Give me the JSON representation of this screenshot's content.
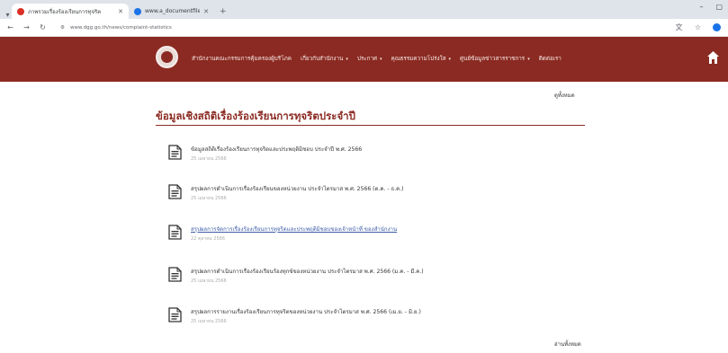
{
  "browser": {
    "tabs": [
      {
        "title": "ภาพรวมเรื่องร้องเรียนการทุจริต",
        "icon": "site-favicon",
        "active": true
      },
      {
        "title": "www.a_documentfile.pdf",
        "icon": "pdf-favicon",
        "active": false
      }
    ],
    "url": "www.dgg.go.th/news/complaint-statistics"
  },
  "site": {
    "nav": [
      {
        "label": "สำนักงานคณะกรรมการคุ้มครองผู้บริโภค",
        "dropdown": false
      },
      {
        "label": "เกี่ยวกับสำนักงาน",
        "dropdown": true
      },
      {
        "label": "ประกาศ",
        "dropdown": true
      },
      {
        "label": "คุณธรรมความโปร่งใส",
        "dropdown": true
      },
      {
        "label": "ศูนย์ข้อมูลข่าวสารราชการ",
        "dropdown": true
      },
      {
        "label": "ติดต่อเรา",
        "dropdown": false
      }
    ],
    "brand_color": "#8b2a22"
  },
  "main": {
    "view_all_top": "ดูทั้งหมด",
    "title": "ข้อมูลเชิงสถิติเรื่องร้องเรียนการทุจริตประจำปี",
    "view_all_bottom": "อ่านทั้งหมด",
    "items": [
      {
        "title": "ข้อมูลสถิติเรื่องร้องเรียนการทุจริตและประพฤติมิชอบ ประจำปี พ.ศ. 2566",
        "date": "25 เมษายน 2566",
        "link": false
      },
      {
        "title": "สรุปผลการดำเนินการเรื่องร้องเรียนของหน่วยงาน ประจำไตรมาส พ.ศ. 2566 (ต.ค. - ธ.ค.)",
        "date": "25 เมษายน 2566",
        "link": false
      },
      {
        "title": "สรุปผลการจัดการเรื่องร้องเรียนการทุจริตและประพฤติมิชอบของเจ้าหน้าที่ ของสำนักงาน",
        "date": "22 ตุลาคม 2566",
        "link": true
      },
      {
        "title": "สรุปผลการดำเนินการเรื่องร้องเรียนร้องทุกข์ของหน่วยงาน ประจำไตรมาส พ.ศ. 2566 (ม.ค. - มี.ค.)",
        "date": "25 เมษายน 2566",
        "link": false
      },
      {
        "title": "สรุปผลการรายงานเรื่องร้องเรียนการทุจริตของหน่วยงาน ประจำไตรมาส พ.ศ. 2566 (เม.ย. - มิ.ย.)",
        "date": "25 เมษายน 2566",
        "link": false
      }
    ]
  }
}
